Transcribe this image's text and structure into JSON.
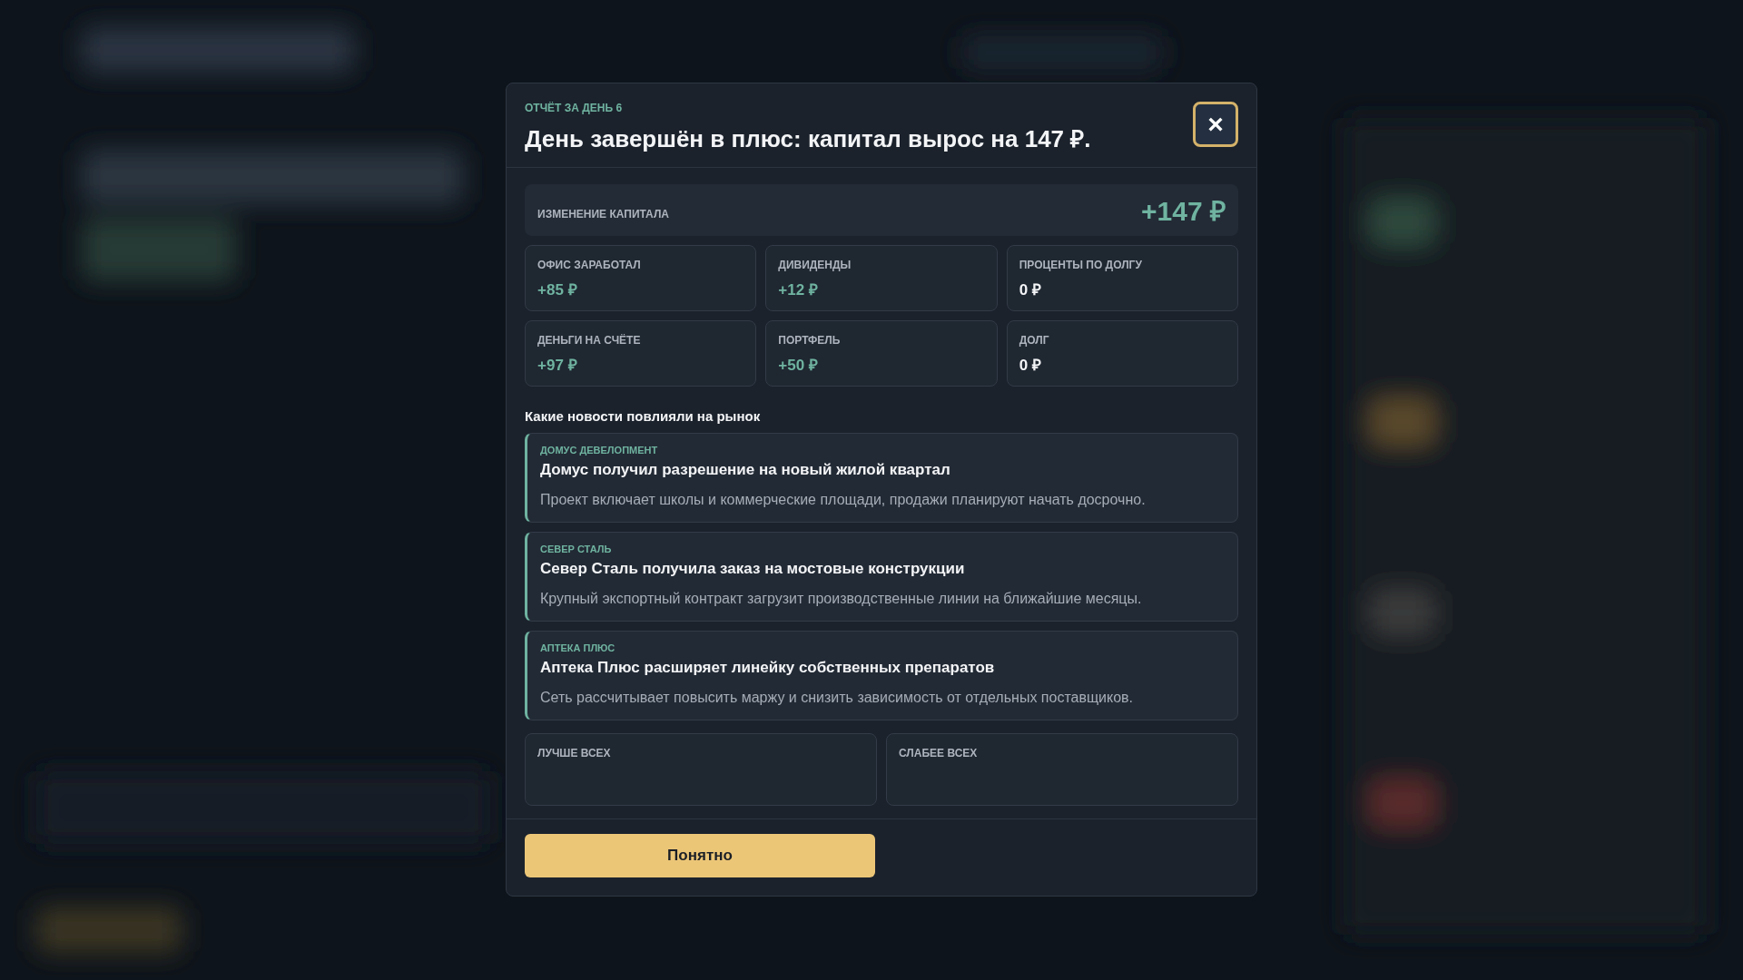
{
  "report": {
    "eyebrow": "ОТЧЁТ ЗА ДЕНЬ 6",
    "title": "День завершён в плюс: капитал вырос на 147 ₽.",
    "close": "×"
  },
  "capital": {
    "label": "ИЗМЕНЕНИЕ КАПИТАЛА",
    "value": "+147 ₽",
    "positive": true
  },
  "stats": [
    {
      "label": "ОФИС ЗАРАБОТАЛ",
      "value": "+85 ₽",
      "positive": true
    },
    {
      "label": "ДИВИДЕНДЫ",
      "value": "+12 ₽",
      "positive": true
    },
    {
      "label": "ПРОЦЕНТЫ ПО ДОЛГУ",
      "value": "0 ₽",
      "positive": false
    },
    {
      "label": "ДЕНЬГИ НА СЧЁТЕ",
      "value": "+97 ₽",
      "positive": true
    },
    {
      "label": "ПОРТФЕЛЬ",
      "value": "+50 ₽",
      "positive": true
    },
    {
      "label": "ДОЛГ",
      "value": "0 ₽",
      "positive": false
    }
  ],
  "news_heading": "Какие новости повлияли на рынок",
  "news": [
    {
      "company": "ДОМУС ДЕВЕЛОПМЕНТ",
      "headline": "Домус получил разрешение на новый жилой квартал",
      "text": "Проект включает школы и коммерческие площади, продажи планируют начать досрочно."
    },
    {
      "company": "СЕВЕР СТАЛЬ",
      "headline": "Север Сталь получила заказ на мостовые конструкции",
      "text": "Крупный экспортный контракт загрузит производственные линии на ближайшие месяцы."
    },
    {
      "company": "АПТЕКА ПЛЮС",
      "headline": "Аптека Плюс расширяет линейку собственных препаратов",
      "text": "Сеть рассчитывает повысить маржу и снизить зависимость от отдельных поставщиков."
    }
  ],
  "leaders": [
    {
      "label": "ЛУЧШЕ ВСЕХ"
    },
    {
      "label": "СЛАБЕЕ ВСЕХ"
    }
  ],
  "confirm_button": "Понятно"
}
